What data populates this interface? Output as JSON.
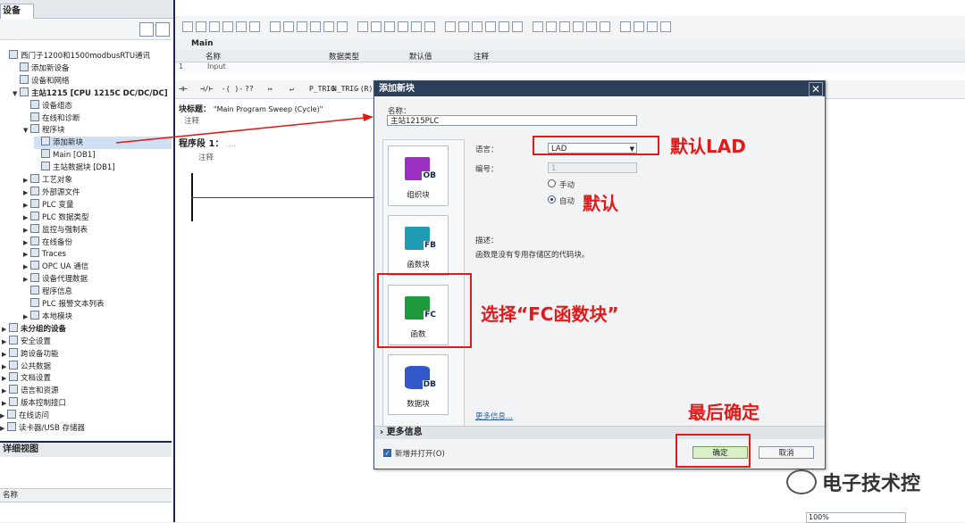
{
  "left_panel": {
    "tab_label": "设备",
    "tree": [
      {
        "label": "西门子1200和1500modbusRTU通讯",
        "level": 0,
        "arrow": "",
        "bold": false,
        "selected": false,
        "icon": "project-icon"
      },
      {
        "label": "添加新设备",
        "level": 1,
        "arrow": "",
        "bold": false,
        "selected": false,
        "icon": "add-device-icon"
      },
      {
        "label": "设备和网络",
        "level": 1,
        "arrow": "",
        "bold": false,
        "selected": false,
        "icon": "network-icon"
      },
      {
        "label": "主站1215 [CPU 1215C DC/DC/DC]",
        "level": 1,
        "arrow": "▼",
        "bold": true,
        "selected": false,
        "icon": "cpu-icon"
      },
      {
        "label": "设备组态",
        "level": 2,
        "arrow": "",
        "bold": false,
        "selected": false,
        "icon": "config-icon"
      },
      {
        "label": "在线和诊断",
        "level": 2,
        "arrow": "",
        "bold": false,
        "selected": false,
        "icon": "diagnostics-icon"
      },
      {
        "label": "程序块",
        "level": 2,
        "arrow": "▼",
        "bold": false,
        "selected": false,
        "icon": "folder-icon"
      },
      {
        "label": "添加新块",
        "level": 3,
        "arrow": "",
        "bold": false,
        "selected": true,
        "icon": "add-block-icon"
      },
      {
        "label": "Main [OB1]",
        "level": 3,
        "arrow": "",
        "bold": false,
        "selected": false,
        "icon": "ob-icon"
      },
      {
        "label": "主站数据块 [DB1]",
        "level": 3,
        "arrow": "",
        "bold": false,
        "selected": false,
        "icon": "db-icon"
      },
      {
        "label": "工艺对象",
        "level": 2,
        "arrow": "▶",
        "bold": false,
        "selected": false,
        "icon": "folder-icon"
      },
      {
        "label": "外部源文件",
        "level": 2,
        "arrow": "▶",
        "bold": false,
        "selected": false,
        "icon": "folder-icon"
      },
      {
        "label": "PLC 变量",
        "level": 2,
        "arrow": "▶",
        "bold": false,
        "selected": false,
        "icon": "folder-icon"
      },
      {
        "label": "PLC 数据类型",
        "level": 2,
        "arrow": "▶",
        "bold": false,
        "selected": false,
        "icon": "folder-icon"
      },
      {
        "label": "监控与强制表",
        "level": 2,
        "arrow": "▶",
        "bold": false,
        "selected": false,
        "icon": "folder-icon"
      },
      {
        "label": "在线备份",
        "level": 2,
        "arrow": "▶",
        "bold": false,
        "selected": false,
        "icon": "folder-icon"
      },
      {
        "label": "Traces",
        "level": 2,
        "arrow": "▶",
        "bold": false,
        "selected": false,
        "icon": "folder-icon"
      },
      {
        "label": "OPC UA 通信",
        "level": 2,
        "arrow": "▶",
        "bold": false,
        "selected": false,
        "icon": "folder-icon"
      },
      {
        "label": "设备代理数据",
        "level": 2,
        "arrow": "▶",
        "bold": false,
        "selected": false,
        "icon": "folder-icon"
      },
      {
        "label": "程序信息",
        "level": 2,
        "arrow": "",
        "bold": false,
        "selected": false,
        "icon": "info-icon"
      },
      {
        "label": "PLC 报警文本列表",
        "level": 2,
        "arrow": "",
        "bold": false,
        "selected": false,
        "icon": "list-icon"
      },
      {
        "label": "本地模块",
        "level": 2,
        "arrow": "▶",
        "bold": false,
        "selected": false,
        "icon": "folder-icon"
      },
      {
        "label": "未分组的设备",
        "level": 0,
        "arrow": "▶",
        "bold": true,
        "selected": false,
        "icon": "folder-icon"
      },
      {
        "label": "安全设置",
        "level": 0,
        "arrow": "▶",
        "bold": false,
        "selected": false,
        "icon": "folder-icon"
      },
      {
        "label": "跨设备功能",
        "level": 0,
        "arrow": "▶",
        "bold": false,
        "selected": false,
        "icon": "folder-icon"
      },
      {
        "label": "公共数据",
        "level": 0,
        "arrow": "▶",
        "bold": false,
        "selected": false,
        "icon": "folder-icon"
      },
      {
        "label": "文档设置",
        "level": 0,
        "arrow": "▶",
        "bold": false,
        "selected": false,
        "icon": "folder-icon"
      },
      {
        "label": "语言和资源",
        "level": 0,
        "arrow": "▶",
        "bold": false,
        "selected": false,
        "icon": "folder-icon"
      },
      {
        "label": "版本控制接口",
        "level": 0,
        "arrow": "▶",
        "bold": false,
        "selected": false,
        "icon": "folder-icon"
      },
      {
        "label": "在线访问",
        "level": -1,
        "arrow": "▶",
        "bold": false,
        "selected": false,
        "icon": "folder-icon"
      },
      {
        "label": "读卡器/USB 存储器",
        "level": -1,
        "arrow": "▶",
        "bold": false,
        "selected": false,
        "icon": "folder-icon"
      }
    ],
    "detail_view_title": "详细视图",
    "detail_column_name": "名称"
  },
  "editor": {
    "interface_title": "Main",
    "columns": {
      "name": "名称",
      "data_type": "数据类型",
      "default_value": "默认值",
      "comment": "注释"
    },
    "interface_row": {
      "index": "1",
      "label": "Input"
    },
    "lad_toolbar": [
      "⊣⊢",
      "⊣/⊢",
      "-( )-",
      "??",
      "↦",
      "↵",
      "P_TRIG",
      "N_TRIG",
      "-(R)-"
    ],
    "block_title_label": "块标题：",
    "block_title_value": "\"Main Program Sweep (Cycle)\"",
    "block_comment": "注释",
    "network_label": "程序段 1：",
    "network_dots": "....",
    "network_comment": "注释",
    "zoom": "100%"
  },
  "dialog": {
    "title": "添加新块",
    "name_label": "名称：",
    "name_value": "主站1215PLC",
    "block_types": [
      {
        "label": "组织块",
        "tag": "OB",
        "color": "#9b2fbf"
      },
      {
        "label": "函数块",
        "tag": "FB",
        "color": "#1f9bb3"
      },
      {
        "label": "函数",
        "tag": "FC",
        "color": "#1e9a3c"
      },
      {
        "label": "数据块",
        "tag": "DB",
        "color": "#3257c9"
      }
    ],
    "language_label": "语言：",
    "language_value": "LAD",
    "number_label": "编号：",
    "number_value": "1",
    "manual_label": "手动",
    "auto_label": "自动",
    "description_label": "描述：",
    "description_text": "函数是没有专用存储区的代码块。",
    "more_info_link": "更多信息...",
    "more_info_section": "更多信息",
    "add_and_open_label": "新增并打开(O)",
    "ok_label": "确定",
    "cancel_label": "取消"
  },
  "annotations": {
    "default_lad": "默认LAD",
    "default": "默认",
    "choose_fc": "选择“FC函数块”",
    "confirm": "最后确定",
    "watermark": "电子技术控"
  },
  "colors": {
    "annotation_red": "#e01b1b",
    "title_bar": "#2b3f59"
  }
}
